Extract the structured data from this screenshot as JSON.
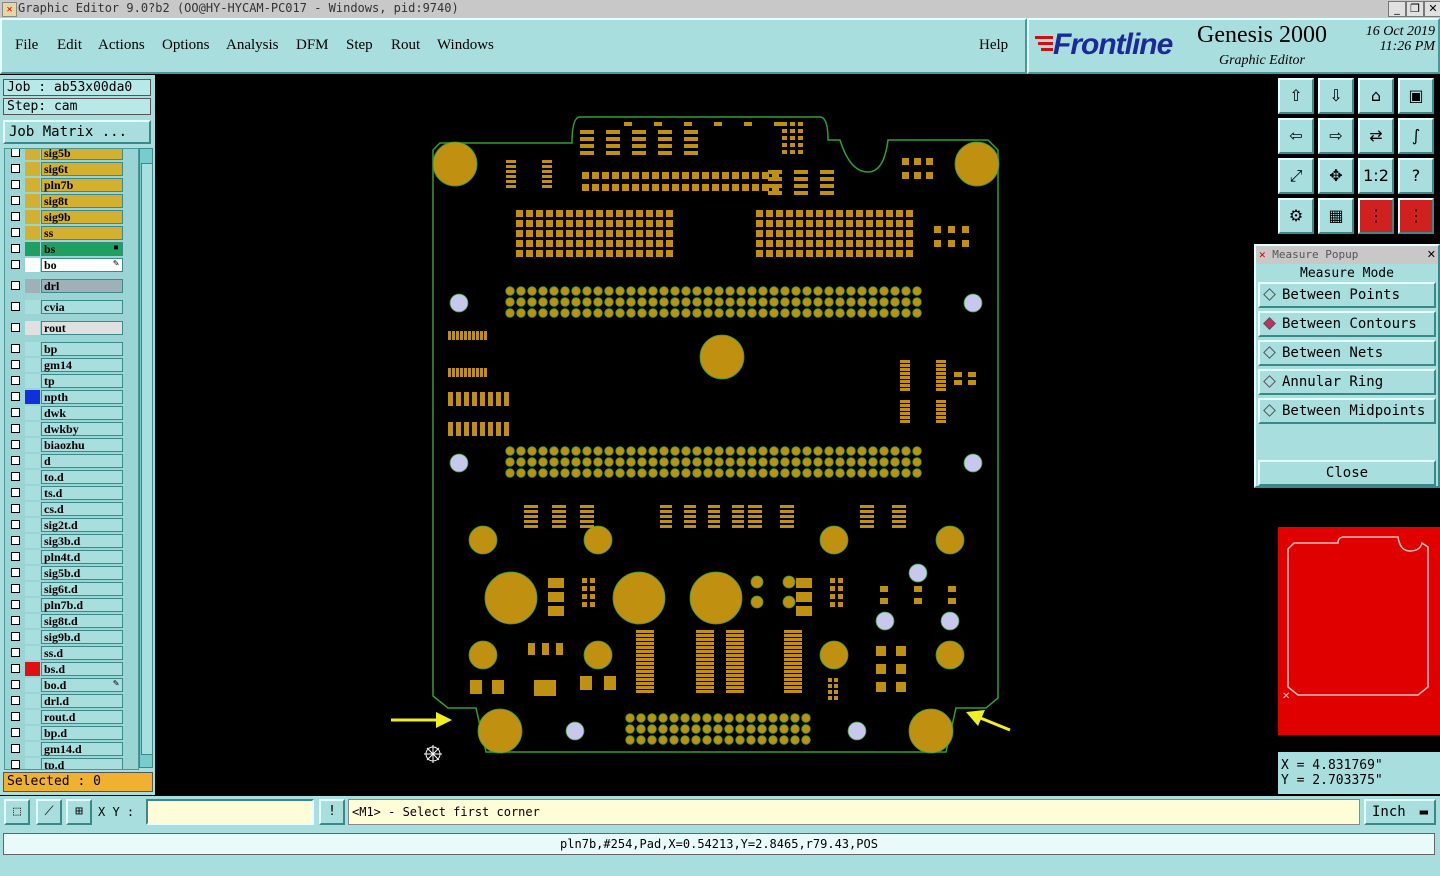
{
  "window": {
    "title": "Graphic Editor 9.0?b2 (OO@HY-HYCAM-PC017 - Windows, pid:9740)",
    "minimize_icon": "_",
    "restore_icon": "❐",
    "close_icon": "✕"
  },
  "menu": [
    {
      "label": "File"
    },
    {
      "label": "Edit"
    },
    {
      "label": "Actions"
    },
    {
      "label": "Options"
    },
    {
      "label": "Analysis"
    },
    {
      "label": "DFM"
    },
    {
      "label": "Step"
    },
    {
      "label": "Rout"
    },
    {
      "label": "Windows"
    }
  ],
  "help_label": "Help",
  "logo": {
    "brand": "Frontline",
    "product": "Genesis 2000",
    "subtitle": "Graphic Editor",
    "date": "16 Oct 2019",
    "time": "11:26 PM"
  },
  "job": {
    "job_label": "Job : ab53x00da0",
    "step_label": "Step: cam",
    "matrix_button": "Job Matrix ..."
  },
  "layers": [
    {
      "name": "sig5b",
      "color": "#d4b030",
      "box": "#d4b030",
      "sep": false
    },
    {
      "name": "sig6t",
      "color": "#d4b030",
      "box": "#d4b030",
      "sep": false
    },
    {
      "name": "pln7b",
      "color": "#d4b030",
      "box": "#d4b030",
      "sep": false
    },
    {
      "name": "sig8t",
      "color": "#d4b030",
      "box": "#d4b030",
      "sep": false
    },
    {
      "name": "sig9b",
      "color": "#d4b030",
      "box": "#d4b030",
      "sep": false
    },
    {
      "name": "ss",
      "color": "#d4b030",
      "box": "#d4b030",
      "sep": false
    },
    {
      "name": "bs",
      "color": "#20a060",
      "box": "#20a060",
      "sep": false,
      "mark": "▪"
    },
    {
      "name": "bo",
      "color": "#ffffff",
      "box": "#ffffff",
      "sep": false,
      "mark": "✎"
    },
    {
      "name": "drl",
      "color": "#a0b0b8",
      "box": "#a0b0b8",
      "sep": true
    },
    {
      "name": "cvia",
      "color": "#a8dede",
      "box": "#a8dede",
      "sep": true
    },
    {
      "name": "rout",
      "color": "#e0e0e0",
      "box": "#e0e0e0",
      "sep": true
    },
    {
      "name": "bp",
      "color": "#a8dede",
      "box": "#a8dede",
      "sep": true
    },
    {
      "name": "gm14",
      "color": "#a8dede",
      "box": "#a8dede",
      "sep": false
    },
    {
      "name": "tp",
      "color": "#a8dede",
      "box": "#a8dede",
      "sep": false
    },
    {
      "name": "npth",
      "color": "#a8dede",
      "box": "#1030e0",
      "sep": false
    },
    {
      "name": "dwk",
      "color": "#a8dede",
      "box": "#a8dede",
      "sep": false
    },
    {
      "name": "dwkby",
      "color": "#a8dede",
      "box": "#a8dede",
      "sep": false
    },
    {
      "name": "biaozhu",
      "color": "#a8dede",
      "box": "#a8dede",
      "sep": false
    },
    {
      "name": "d",
      "color": "#a8dede",
      "box": "#a8dede",
      "sep": false
    },
    {
      "name": "to.d",
      "color": "#a8dede",
      "box": "#a8dede",
      "sep": false
    },
    {
      "name": "ts.d",
      "color": "#a8dede",
      "box": "#a8dede",
      "sep": false
    },
    {
      "name": "cs.d",
      "color": "#a8dede",
      "box": "#a8dede",
      "sep": false
    },
    {
      "name": "sig2t.d",
      "color": "#a8dede",
      "box": "#a8dede",
      "sep": false
    },
    {
      "name": "sig3b.d",
      "color": "#a8dede",
      "box": "#a8dede",
      "sep": false
    },
    {
      "name": "pln4t.d",
      "color": "#a8dede",
      "box": "#a8dede",
      "sep": false
    },
    {
      "name": "sig5b.d",
      "color": "#a8dede",
      "box": "#a8dede",
      "sep": false
    },
    {
      "name": "sig6t.d",
      "color": "#a8dede",
      "box": "#a8dede",
      "sep": false
    },
    {
      "name": "pln7b.d",
      "color": "#a8dede",
      "box": "#a8dede",
      "sep": false
    },
    {
      "name": "sig8t.d",
      "color": "#a8dede",
      "box": "#a8dede",
      "sep": false
    },
    {
      "name": "sig9b.d",
      "color": "#a8dede",
      "box": "#a8dede",
      "sep": false
    },
    {
      "name": "ss.d",
      "color": "#a8dede",
      "box": "#a8dede",
      "sep": false
    },
    {
      "name": "bs.d",
      "color": "#a8dede",
      "box": "#e01010",
      "sep": false
    },
    {
      "name": "bo.d",
      "color": "#a8dede",
      "box": "#a8dede",
      "sep": false,
      "mark": "✎"
    },
    {
      "name": "drl.d",
      "color": "#a8dede",
      "box": "#a8dede",
      "sep": false
    },
    {
      "name": "rout.d",
      "color": "#a8dede",
      "box": "#a8dede",
      "sep": false
    },
    {
      "name": "bp.d",
      "color": "#a8dede",
      "box": "#a8dede",
      "sep": false
    },
    {
      "name": "gm14.d",
      "color": "#a8dede",
      "box": "#a8dede",
      "sep": false
    },
    {
      "name": "tp.d",
      "color": "#a8dede",
      "box": "#a8dede",
      "sep": false
    }
  ],
  "selected_label": "Selected : 0",
  "toolbar_icons": [
    "load-layer-icon",
    "save-icon",
    "home-icon",
    "panel-icon",
    "zoom-back-icon",
    "zoom-forward-icon",
    "flip-icon",
    "wave-icon",
    "zoom-fit-icon",
    "pan-center-icon",
    "scale-1-2-icon",
    "help-icon",
    "tools-icon",
    "grid-icon",
    "net-icon",
    "net-select-icon"
  ],
  "toolbar_glyphs": [
    "⇧",
    "⇩",
    "⌂",
    "▣",
    "⇦",
    "⇨",
    "⇄",
    "∫",
    "⤢",
    "✥",
    "1:2",
    "?",
    "⚙",
    "▦",
    "⋮",
    "⋮"
  ],
  "measure": {
    "title": "Measure Popup",
    "mode_label": "Measure Mode",
    "options": [
      {
        "label": "Between Points",
        "selected": false
      },
      {
        "label": "Between Contours",
        "selected": true
      },
      {
        "label": "Between Nets",
        "selected": false
      },
      {
        "label": "Annular Ring",
        "selected": false
      },
      {
        "label": "Between Midpoints",
        "selected": false
      }
    ],
    "close_label": "Close"
  },
  "coords": {
    "x": "X = 4.831769\"",
    "y": "Y = 2.703375\""
  },
  "bottom": {
    "xy_label": "X Y :",
    "xy_value": "",
    "prompt": "<M1> - Select first corner",
    "unit": "Inch"
  },
  "status": "pln7b,#254,Pad,X=0.54213,Y=2.8465,r79.43,POS",
  "colors": {
    "pad": "#c09010",
    "outline": "#30a030",
    "drill": "#c8c8ee",
    "arrow": "#f0f020",
    "preview": "#e00000"
  }
}
